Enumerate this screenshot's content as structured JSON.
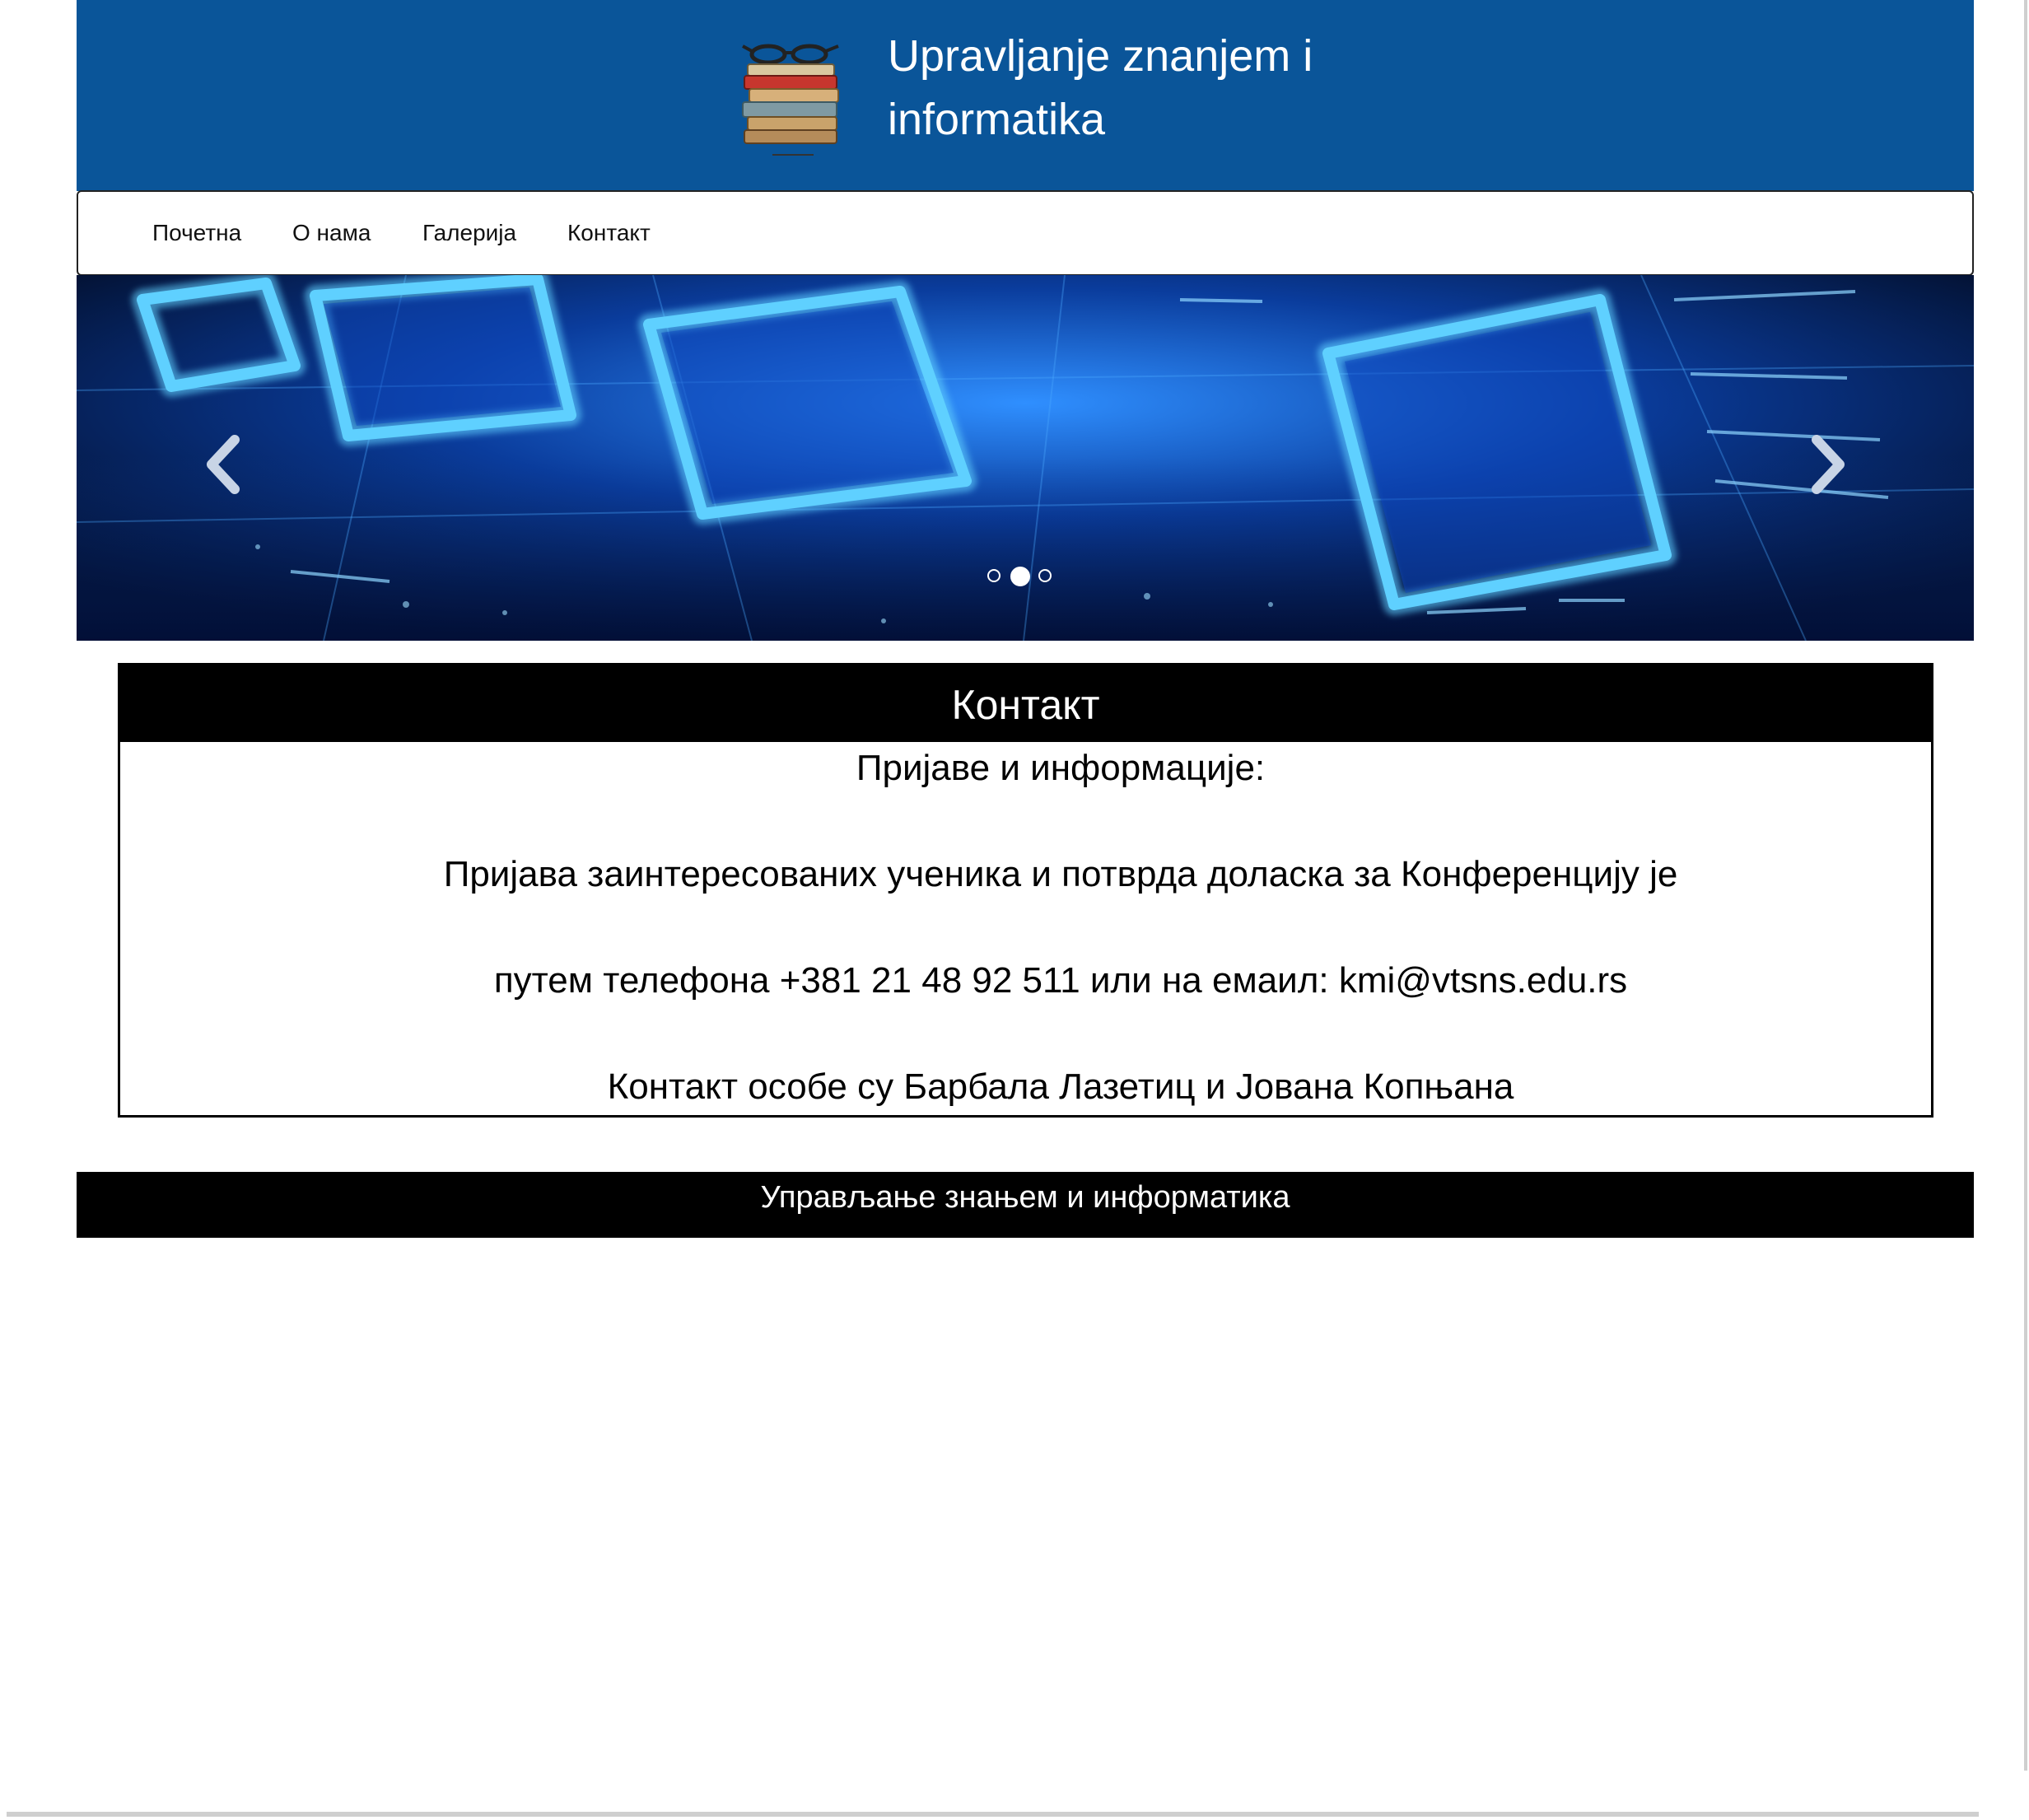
{
  "header": {
    "title_line1": "Upravljanje znanjem i",
    "title_line2": "informatika",
    "logo_icon": "book-stack-with-glasses-icon",
    "background_color": "#0a5599"
  },
  "nav": {
    "items": [
      {
        "label": "Почетна"
      },
      {
        "label": "О нама"
      },
      {
        "label": "Галерија"
      },
      {
        "label": "Контакт"
      }
    ]
  },
  "carousel": {
    "prev_icon": "chevron-left-icon",
    "next_icon": "chevron-right-icon",
    "slide_count": 3,
    "active_slide": 2
  },
  "contact": {
    "heading": "Контакт",
    "lines": [
      "Пријаве и информације:",
      "Пријава заинтересованих ученика и потврда доласка за Конференцију је",
      "путем телефона +381 21 48 92 511 или на емаил: kmi@vtsns.edu.rs",
      "Контакт особе су Барбала Лазетиц и Јована Копњана"
    ]
  },
  "footer": {
    "text": "Управљање знањем и информатика"
  }
}
